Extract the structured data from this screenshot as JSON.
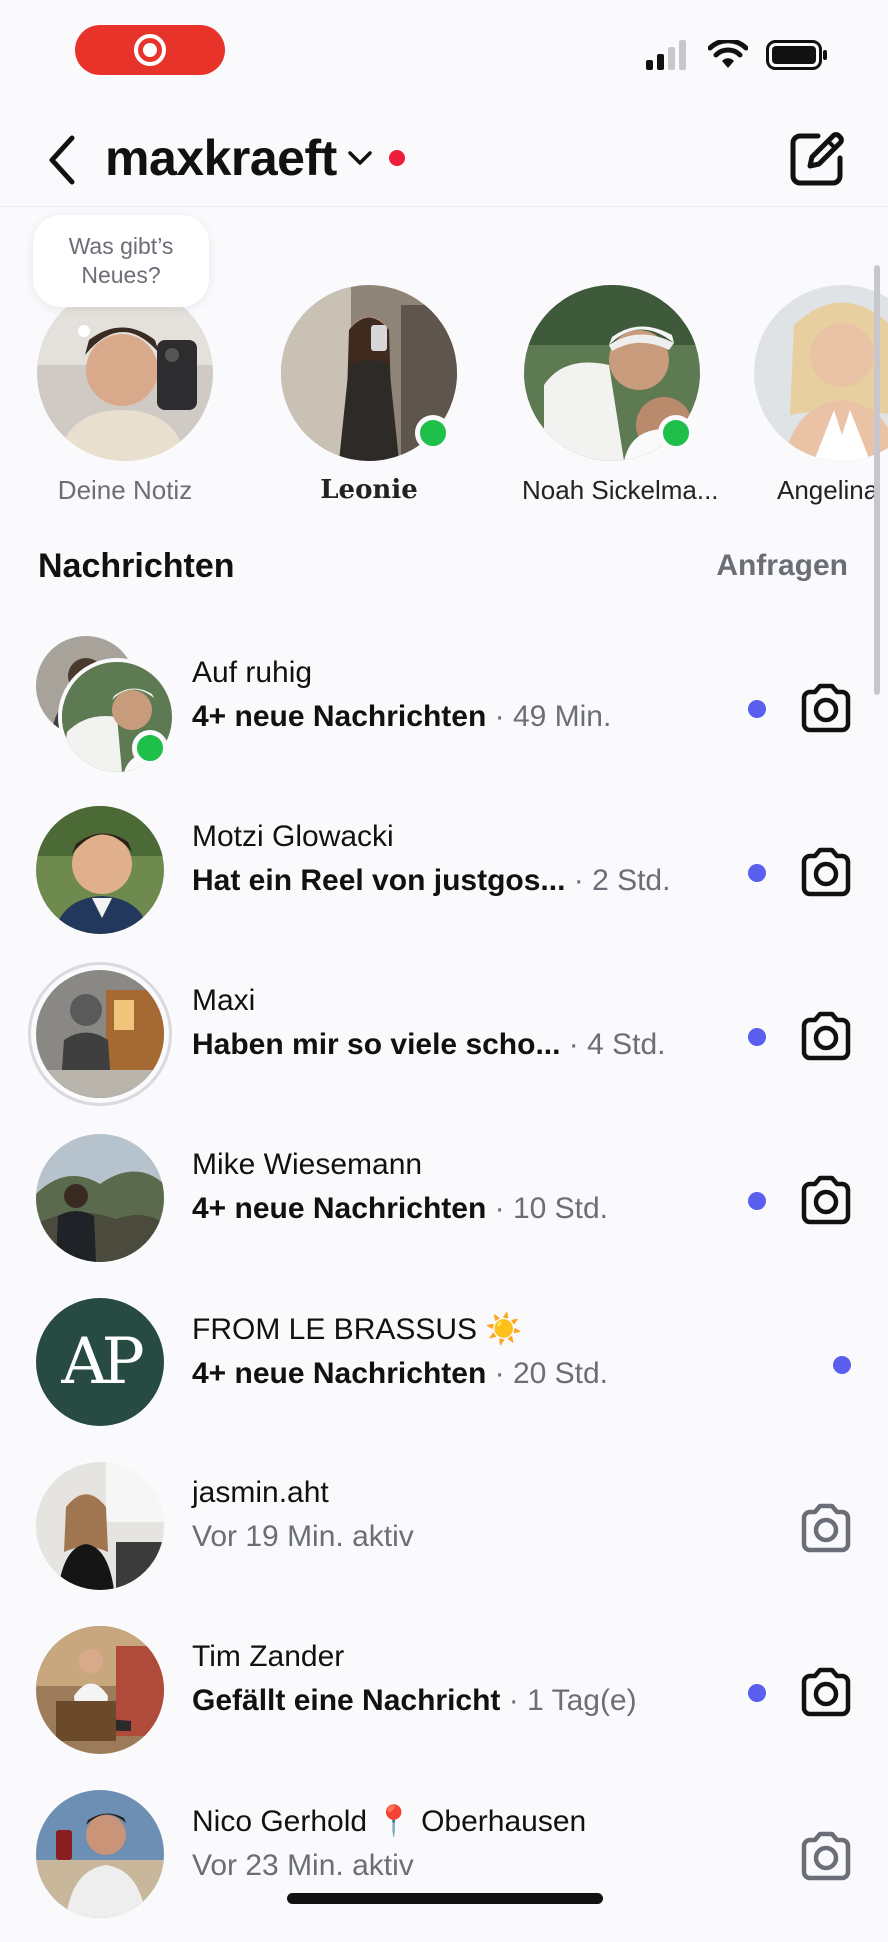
{
  "header": {
    "account_name": "maxkraeft"
  },
  "colors": {
    "recording": "#e8332b",
    "unread": "#5a5ff0",
    "online": "#1ec04a",
    "badge": "#ee1d3a"
  },
  "notes": {
    "bubble_text": "Was gibt’s Neues?",
    "items": [
      {
        "label": "Deine Notiz"
      },
      {
        "label": "Leonie"
      },
      {
        "label": "Noah Sickelma..."
      },
      {
        "label": "Angelina"
      }
    ]
  },
  "section": {
    "title": "Nachrichten",
    "requests_label": "Anfragen"
  },
  "chats": [
    {
      "name": "Auf ruhig",
      "sub": "4+ neue Nachrichten",
      "time": " · 49 Min."
    },
    {
      "name": "Motzi Glowacki",
      "sub": "Hat ein Reel von justgos...",
      "time": " · 2 Std."
    },
    {
      "name": "Maxi",
      "sub": "Haben mir so viele scho...",
      "time": " · 4 Std."
    },
    {
      "name": "Mike Wiesemann",
      "sub": "4+ neue Nachrichten",
      "time": " · 10 Std."
    },
    {
      "name": "FROM LE BRASSUS ☀️",
      "sub": "4+ neue Nachrichten",
      "time": " · 20 Std."
    },
    {
      "name": "jasmin.aht",
      "status": "Vor 19 Min. aktiv"
    },
    {
      "name": "Tim Zander",
      "sub": "Gefällt eine Nachricht",
      "time": " · 1 Tag(e)"
    },
    {
      "name": "Nico Gerhold 📍 Oberhausen",
      "status": "Vor 23 Min. aktiv"
    }
  ],
  "ap_logo_text": "AP"
}
